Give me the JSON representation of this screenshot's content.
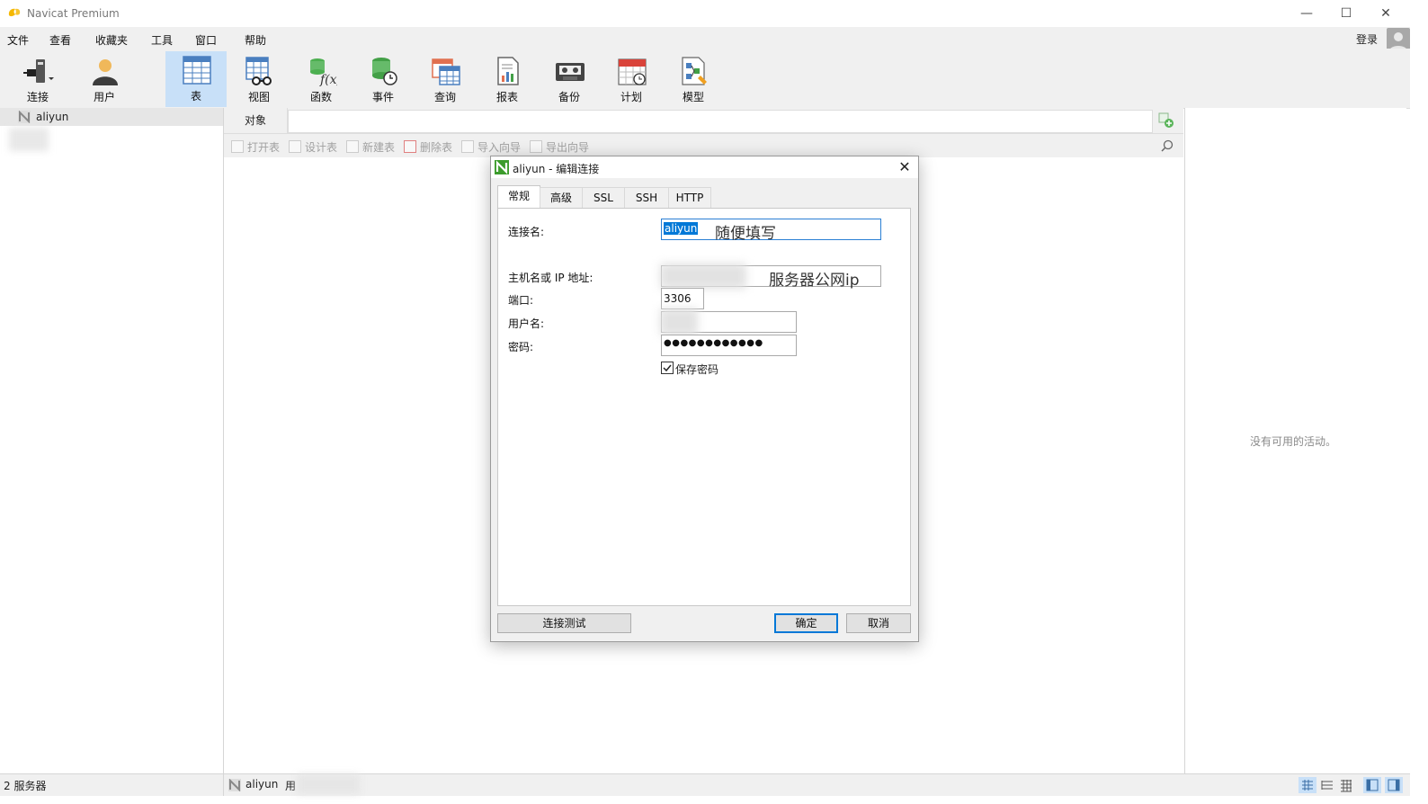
{
  "app": {
    "title": "Navicat Premium"
  },
  "window": {
    "minimize": "—",
    "maximize": "☐",
    "close": "✕"
  },
  "menu": [
    "文件",
    "查看",
    "收藏夹",
    "工具",
    "窗口",
    "帮助"
  ],
  "login_label": "登录",
  "toolbar": [
    {
      "label": "连接",
      "icon": "plug-icon"
    },
    {
      "label": "用户",
      "icon": "user-icon"
    },
    {
      "label": "表",
      "icon": "table-icon"
    },
    {
      "label": "视图",
      "icon": "view-icon"
    },
    {
      "label": "函数",
      "icon": "function-icon"
    },
    {
      "label": "事件",
      "icon": "event-icon"
    },
    {
      "label": "查询",
      "icon": "query-icon"
    },
    {
      "label": "报表",
      "icon": "report-icon"
    },
    {
      "label": "备份",
      "icon": "backup-icon"
    },
    {
      "label": "计划",
      "icon": "schedule-icon"
    },
    {
      "label": "模型",
      "icon": "model-icon"
    }
  ],
  "sidebar": {
    "connection_name": "aliyun"
  },
  "object_tab": "对象",
  "actions": [
    "打开表",
    "设计表",
    "新建表",
    "删除表",
    "导入向导",
    "导出向导"
  ],
  "right_panel": {
    "empty_text": "没有可用的活动。"
  },
  "status": {
    "left": "2 服务器",
    "connection": "aliyun",
    "user": "用"
  },
  "dialog": {
    "title": "aliyun - 编辑连接",
    "tabs": [
      "常规",
      "高级",
      "SSL",
      "SSH",
      "HTTP"
    ],
    "labels": {
      "conn_name": "连接名:",
      "host": "主机名或 IP 地址:",
      "port": "端口:",
      "username": "用户名:",
      "password": "密码:"
    },
    "values": {
      "conn_name": "aliyun",
      "conn_name_note": "随便填写",
      "host_note": "服务器公网ip",
      "port": "3306",
      "password": "●●●●●●●●●●●●"
    },
    "save_password": {
      "label": "保存密码",
      "checked": true
    },
    "buttons": {
      "test": "连接测试",
      "ok": "确定",
      "cancel": "取消"
    }
  },
  "colors": {
    "toolbar_active": "#c8e0f8",
    "selection": "#0078d7",
    "navicat_green": "#3c9c2c"
  }
}
